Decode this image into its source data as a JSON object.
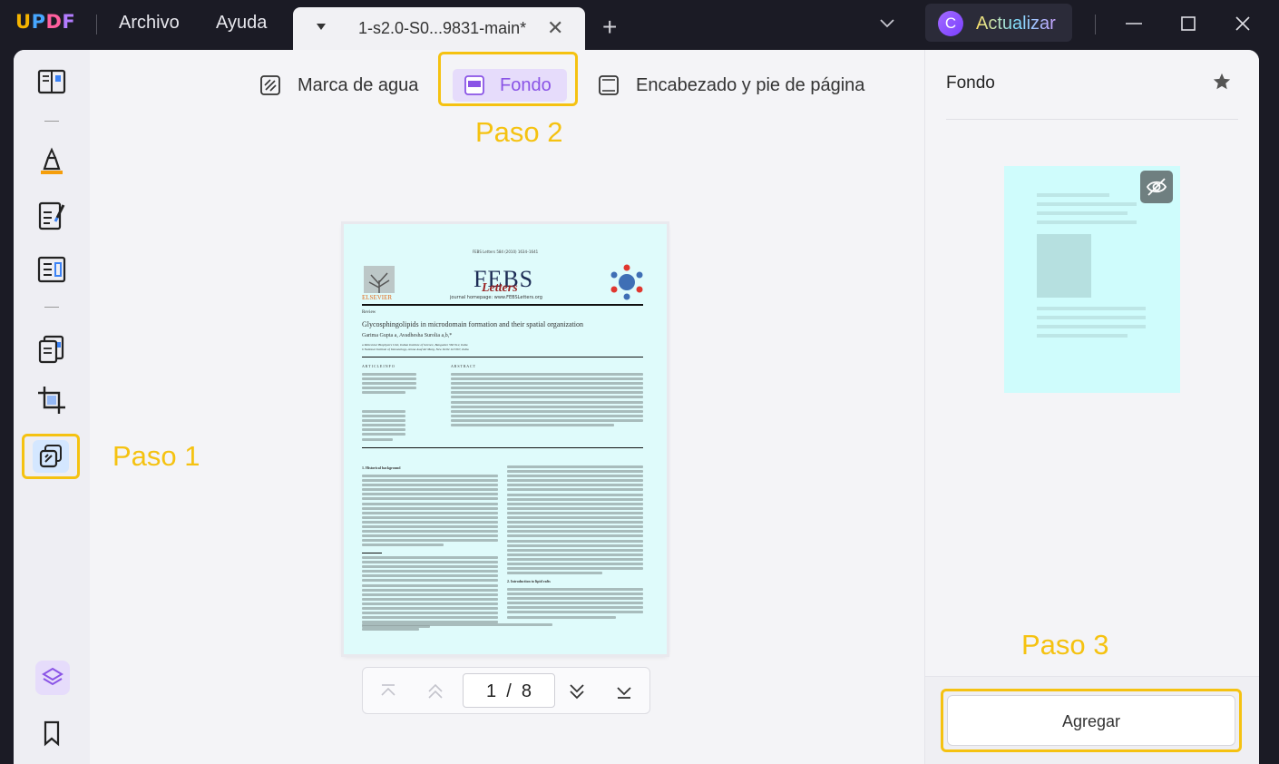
{
  "app": {
    "logo": {
      "p1": "U",
      "p2": "P",
      "p3": "D",
      "p4": "F"
    }
  },
  "menu": {
    "file": "Archivo",
    "help": "Ayuda"
  },
  "tab": {
    "name": "1-s2.0-S0...9831-main*"
  },
  "upgrade": {
    "avatar_letter": "C",
    "label": "Actualizar"
  },
  "toolbar": {
    "watermark": "Marca de agua",
    "background": "Fondo",
    "header_footer": "Encabezado y pie de página"
  },
  "steps": {
    "step1": "Paso 1",
    "step2": "Paso 2",
    "step3": "Paso 3"
  },
  "document": {
    "journal_line": "FEBS Letters 584 (2010) 1634–1641",
    "journal_name": "FEBS",
    "journal_script": "Letters",
    "publisher": "ELSEVIER",
    "homepage": "journal homepage: www.FEBSLetters.org",
    "section": "Review",
    "title": "Glycosphingolipids in microdomain formation and their spatial organization",
    "authors": "Garima Gupta a, Avadhesha Surolia a,b,*",
    "affil1": "a Molecular Biophysics Unit, Indian Institute of Science, Bangalore 560 012, India",
    "affil2": "b National Institute of Immunology, Aruna Asaf Ali Marg, New Delhi 110 067, India",
    "article_info": "A R T I C L E   I N F O",
    "abstract": "A B S T R A C T",
    "historical": "1. Historical background",
    "intro_rafts": "2. Introduction to lipid rafts"
  },
  "pager": {
    "current": "1",
    "sep": "/",
    "total": "8"
  },
  "right_panel": {
    "title": "Fondo",
    "add_button": "Agregar"
  }
}
